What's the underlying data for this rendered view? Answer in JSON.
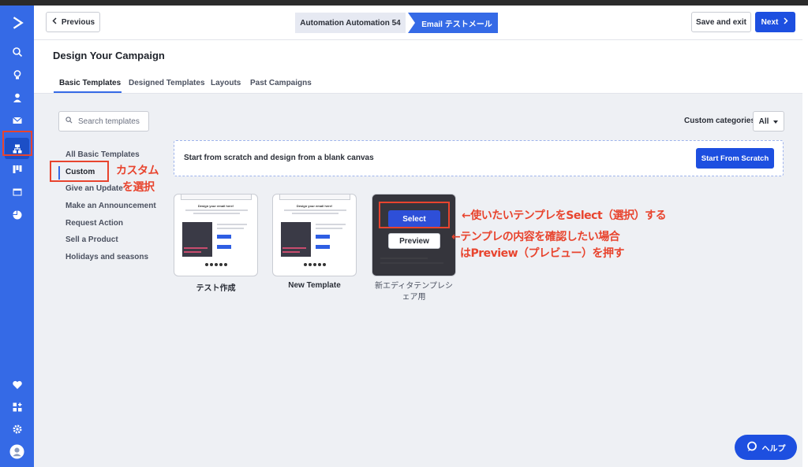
{
  "header": {
    "prev_label": "Previous",
    "step1_label": "Automation Automation 54",
    "step2_label": "Email テストメール",
    "save_label": "Save and exit",
    "next_label": "Next"
  },
  "page": {
    "title": "Design Your Campaign",
    "tabs": [
      "Basic Templates",
      "Designed Templates",
      "Layouts",
      "Past Campaigns"
    ]
  },
  "search": {
    "placeholder": "Search templates"
  },
  "categories_filter": {
    "label": "Custom categories",
    "value": "All"
  },
  "category_list": [
    "All Basic Templates",
    "Custom",
    "Give an Update",
    "Make an Announcement",
    "Request Action",
    "Sell a Product",
    "Holidays and seasons"
  ],
  "scratch": {
    "text": "Start from scratch and design from a blank canvas",
    "button": "Start From Scratch"
  },
  "templates": [
    {
      "name": "テスト作成",
      "thumb_title": "Design your email here!"
    },
    {
      "name": "New Template",
      "thumb_title": "Design your email here!"
    },
    {
      "name": "新エディタテンプレシェア用",
      "select_label": "Select",
      "preview_label": "Preview"
    }
  ],
  "annotations": {
    "custom_note_line1": "カスタム",
    "custom_note_line2": "を選択",
    "select_note": "←使いたいテンプレをSelect（選択）する",
    "preview_note_line1": "←テンプレの内容を確認したい場合",
    "preview_note_line2": "はPreview（プレビュー）を押す"
  },
  "help": {
    "label": "ヘルプ"
  },
  "sidebar": {
    "icons": [
      "logo-icon",
      "search-icon",
      "lightbulb-icon",
      "contacts-icon",
      "email-icon",
      "automations-icon",
      "pipelines-icon",
      "website-icon",
      "reports-icon",
      "heart-icon",
      "apps-icon",
      "settings-icon",
      "avatar-icon"
    ]
  },
  "colors": {
    "brand": "#356ae6",
    "primary_button": "#1d4fe0",
    "annotation": "#e8442e"
  }
}
